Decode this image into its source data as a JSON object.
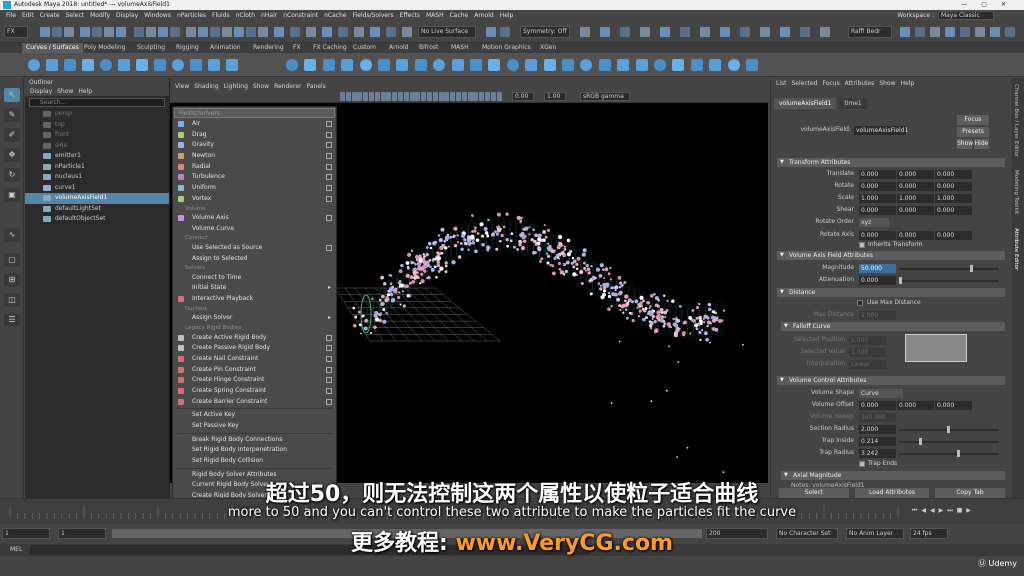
{
  "title_bar": {
    "title": "Autodesk Maya 2018: untitled*   ---   volumeAxisField1"
  },
  "menu_bar": {
    "items": [
      "File",
      "Edit",
      "Create",
      "Select",
      "Modify",
      "Display",
      "Windows",
      "nParticles",
      "Fluids",
      "nCloth",
      "nHair",
      "nConstraint",
      "nCache",
      "Fields/Solvers",
      "Effects",
      "MASH",
      "Cache",
      "Arnold",
      "Help"
    ],
    "workspace_label": "Workspace :",
    "workspace_value": "Maya Classic"
  },
  "status_line": {
    "mode": "FX",
    "live_surface": "No Live Surface",
    "symmetry": "Symmetry: Off",
    "user": "Raffi Bedr"
  },
  "shelf_tabs": [
    "Curves / Surfaces",
    "Poly Modeling",
    "Sculpting",
    "Rigging",
    "Animation",
    "Rendering",
    "FX",
    "FX Caching",
    "Custom",
    "Arnold",
    "Bifrost",
    "MASH",
    "Motion Graphics",
    "XGen"
  ],
  "outliner": {
    "title": "Outliner",
    "menu": [
      "Display",
      "Show",
      "Help"
    ],
    "search_placeholder": "Search...",
    "items": [
      "persp",
      "top",
      "front",
      "side",
      "emitter1",
      "nParticle1",
      "nucleus1",
      "curve1",
      "volumeAxisField1",
      "defaultLightSet",
      "defaultObjectSet"
    ]
  },
  "viewport": {
    "menu": [
      "View",
      "Shading",
      "Lighting",
      "Show",
      "Renderer",
      "Panels"
    ],
    "field_a": "0.00",
    "field_b": "1.00",
    "color_space": "sRGB gamma"
  },
  "fields_menu": {
    "title": "Fields/Solvers",
    "items": [
      {
        "type": "item",
        "label": "Air",
        "opt": true,
        "color": "#7fb0e0"
      },
      {
        "type": "item",
        "label": "Drag",
        "opt": true,
        "color": "#9bd17f"
      },
      {
        "type": "item",
        "label": "Gravity",
        "opt": true,
        "color": "#8fb8e8"
      },
      {
        "type": "item",
        "label": "Newton",
        "opt": true,
        "color": "#d0a060"
      },
      {
        "type": "item",
        "label": "Radial",
        "opt": true,
        "color": "#e08080"
      },
      {
        "type": "item",
        "label": "Turbulence",
        "opt": true,
        "color": "#c080d0"
      },
      {
        "type": "item",
        "label": "Uniform",
        "opt": true,
        "color": "#80c0d0"
      },
      {
        "type": "item",
        "label": "Vortex",
        "opt": true,
        "color": "#a0d080"
      },
      {
        "type": "section",
        "label": "Volume"
      },
      {
        "type": "item",
        "label": "Volume Axis",
        "opt": true,
        "color": "#d090e0"
      },
      {
        "type": "item",
        "label": "Volume Curve",
        "opt": false,
        "color": ""
      },
      {
        "type": "section",
        "label": "Connect"
      },
      {
        "type": "item",
        "label": "Use Selected as Source",
        "opt": true,
        "color": ""
      },
      {
        "type": "item",
        "label": "Assign to Selected",
        "opt": false,
        "color": ""
      },
      {
        "type": "section",
        "label": "Solvers"
      },
      {
        "type": "item",
        "label": "Connect to Time",
        "opt": false,
        "color": ""
      },
      {
        "type": "item",
        "label": "Initial State",
        "opt": false,
        "arrow": true,
        "color": ""
      },
      {
        "type": "item",
        "label": "Interactive Playback",
        "opt": false,
        "color": "#e07070"
      },
      {
        "type": "section",
        "label": "Nucleus"
      },
      {
        "type": "item",
        "label": "Assign Solver",
        "opt": false,
        "arrow": true,
        "color": ""
      },
      {
        "type": "section",
        "label": "Legacy Rigid Bodies"
      },
      {
        "type": "item",
        "label": "Create Active Rigid Body",
        "opt": true,
        "color": "#c0c0c0"
      },
      {
        "type": "item",
        "label": "Create Passive Rigid Body",
        "opt": true,
        "color": "#c0c0c0"
      },
      {
        "type": "item",
        "label": "Create Nail Constraint",
        "opt": true,
        "color": "#d07070"
      },
      {
        "type": "item",
        "label": "Create Pin Constraint",
        "opt": true,
        "color": "#d07070"
      },
      {
        "type": "item",
        "label": "Create Hinge Constraint",
        "opt": true,
        "color": "#d07070"
      },
      {
        "type": "item",
        "label": "Create Spring Constraint",
        "opt": true,
        "color": "#d07070"
      },
      {
        "type": "item",
        "label": "Create Barrier Constraint",
        "opt": true,
        "color": "#d07070"
      },
      {
        "type": "divider"
      },
      {
        "type": "item",
        "label": "Set Active Key",
        "opt": false,
        "color": ""
      },
      {
        "type": "item",
        "label": "Set Passive Key",
        "opt": false,
        "color": ""
      },
      {
        "type": "divider"
      },
      {
        "type": "item",
        "label": "Break Rigid Body Connections",
        "opt": false,
        "color": ""
      },
      {
        "type": "item",
        "label": "Set Rigid Body Interpenetration",
        "opt": false,
        "color": ""
      },
      {
        "type": "item",
        "label": "Set Rigid Body Collision",
        "opt": false,
        "color": ""
      },
      {
        "type": "divider"
      },
      {
        "type": "item",
        "label": "Rigid Body Solver Attributes",
        "opt": false,
        "color": ""
      },
      {
        "type": "item",
        "label": "Current Rigid Body Solver",
        "opt": false,
        "color": ""
      },
      {
        "type": "item",
        "label": "Create Rigid Body Solver",
        "opt": false,
        "color": ""
      }
    ]
  },
  "attribute_editor": {
    "menu": [
      "List",
      "Selected",
      "Focus",
      "Attributes",
      "Show",
      "Help"
    ],
    "tabs": [
      "volumeAxisField1",
      "time1"
    ],
    "node_label": "volumeAxisField:",
    "node_value": "volumeAxisField1",
    "buttons": {
      "focus": "Focus",
      "presets": "Presets",
      "show": "Show",
      "hide": "Hide"
    },
    "transform": {
      "title": "Transform Attributes",
      "translate_label": "Translate",
      "translate": [
        "0.000",
        "0.000",
        "0.000"
      ],
      "rotate_label": "Rotate",
      "rotate": [
        "0.000",
        "0.000",
        "0.000"
      ],
      "scale_label": "Scale",
      "scale": [
        "1.000",
        "1.000",
        "1.000"
      ],
      "shear_label": "Shear",
      "shear": [
        "0.000",
        "0.000",
        "0.000"
      ],
      "rotate_order_label": "Rotate Order",
      "rotate_order": "xyz",
      "rotate_axis_label": "Rotate Axis",
      "rotate_axis": [
        "0.000",
        "0.000",
        "0.000"
      ],
      "inherits_label": "Inherits Transform"
    },
    "field_attrs": {
      "title": "Volume Axis Field Attributes",
      "magnitude_label": "Magnitude",
      "magnitude": "50.000",
      "attenuation_label": "Attenuation",
      "attenuation": "0.000"
    },
    "distance": {
      "title": "Distance",
      "use_max_label": "Use Max Distance",
      "max_label": "Max Distance",
      "max": "1.000"
    },
    "falloff": {
      "title": "Falloff Curve",
      "selected_position_label": "Selected Position",
      "selected_position": "1.000",
      "selected_value_label": "Selected Value",
      "selected_value": "1.000",
      "interpolation_label": "Interpolation",
      "interpolation": "Linear"
    },
    "volume_control": {
      "title": "Volume Control Attributes",
      "shape_label": "Volume Shape",
      "shape": "Curve",
      "offset_label": "Volume Offset",
      "offset": [
        "0.000",
        "0.000",
        "0.000"
      ],
      "sweep_label": "Volume Sweep",
      "sweep": "360.000",
      "section_radius_label": "Section Radius",
      "section_radius": "2.000",
      "trap_inside_label": "Trap Inside",
      "trap_inside": "0.214",
      "trap_radius_label": "Trap Radius",
      "trap_radius": "3.242",
      "trap_ends_label": "Trap Ends"
    },
    "next_frame": "Axial Magnitude",
    "notes_label": "Notes: volumeAxisField1",
    "bottom_buttons": [
      "Select",
      "Load Attributes",
      "Copy Tab"
    ],
    "side_tabs": [
      "Channel Box / Layer Editor",
      "Modeling Toolkit",
      "Attribute Editor"
    ]
  },
  "timeline": {
    "range_start": "1",
    "range_start2": "1",
    "range_end": "200",
    "character_set": "No Character Set",
    "anim_layer": "No Anim Layer",
    "fps": "24 fps"
  },
  "command_line": {
    "label": "MEL"
  },
  "subtitles": {
    "zh": "超过50，则无法控制这两个属性以使粒子适合曲线",
    "en": "more to 50 and you can't control these two attribute to make the particles fit the curve",
    "zh2_prefix": "更多教程:",
    "zh2_url": "www.VeryCG.com"
  },
  "watermark": "Udemy",
  "colors": {
    "selection": "#5285a6",
    "accent_url": "#ff9b21"
  }
}
